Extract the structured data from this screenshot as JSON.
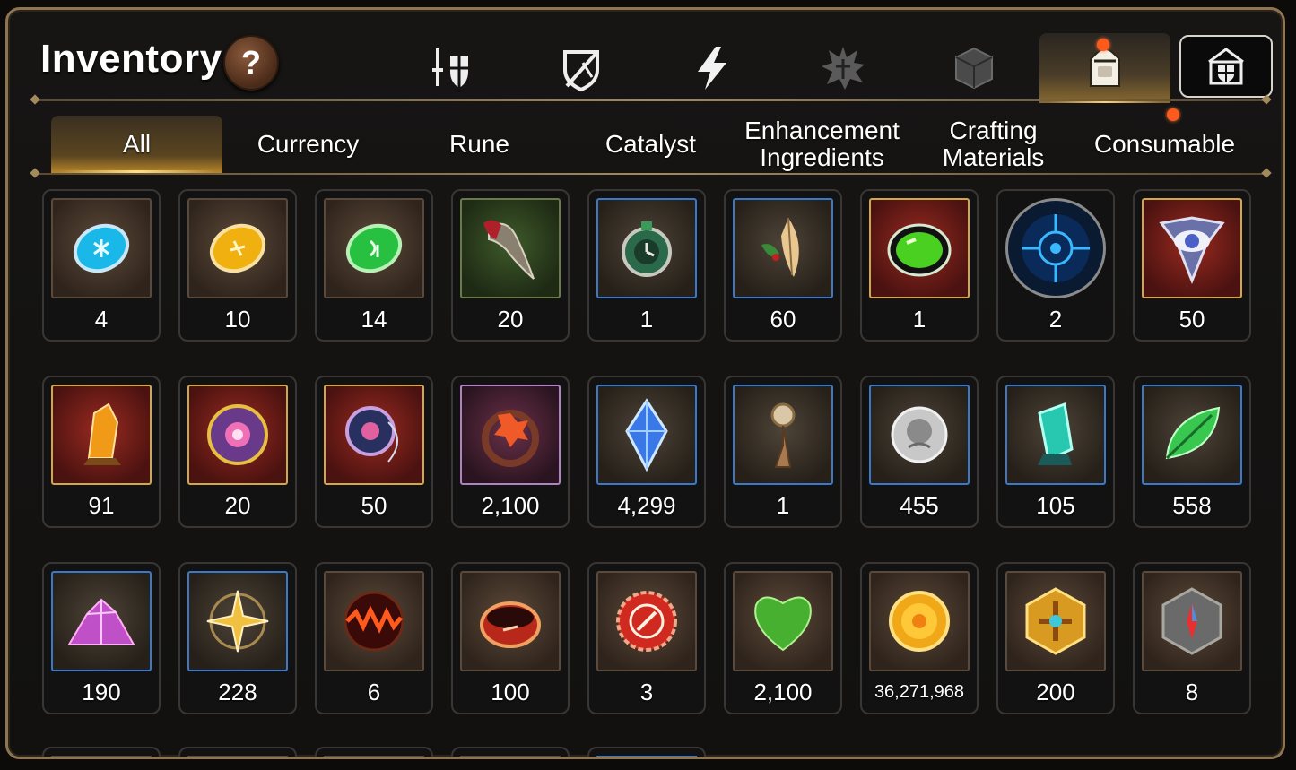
{
  "window": {
    "title": "Inventory",
    "help_label": "?"
  },
  "category_tabs": [
    {
      "icon": "knight-shield-icon",
      "active": false
    },
    {
      "icon": "broken-shield-icon",
      "active": false
    },
    {
      "icon": "lightning-icon",
      "active": false
    },
    {
      "icon": "rune-burst-icon",
      "active": false
    },
    {
      "icon": "cube-icon",
      "active": false
    },
    {
      "icon": "backpack-icon",
      "active": true,
      "notification": true
    }
  ],
  "guild_button": {
    "icon": "guild-castle-icon"
  },
  "subtabs": [
    {
      "label": "All",
      "active": true
    },
    {
      "label": "Currency",
      "active": false
    },
    {
      "label": "Rune",
      "active": false
    },
    {
      "label": "Catalyst",
      "active": false
    },
    {
      "label": "Enhancement\nIngredients",
      "active": false
    },
    {
      "label": "Crafting\nMaterials",
      "active": false
    },
    {
      "label": "Consumable",
      "active": false,
      "notification": true
    }
  ],
  "items": [
    {
      "icon": "blue-gem-icon",
      "count": "4",
      "rarity": "common"
    },
    {
      "icon": "yellow-gem-icon",
      "count": "10",
      "rarity": "common"
    },
    {
      "icon": "green-gem-icon",
      "count": "14",
      "rarity": "common"
    },
    {
      "icon": "claw-icon",
      "count": "20",
      "rarity": "uncommon"
    },
    {
      "icon": "pocket-watch-icon",
      "count": "1",
      "rarity": "rare"
    },
    {
      "icon": "feather-charm-icon",
      "count": "60",
      "rarity": "rare"
    },
    {
      "icon": "green-orb-icon",
      "count": "1",
      "rarity": "legend"
    },
    {
      "icon": "blue-rune-circle-icon",
      "count": "2",
      "rarity": "circle"
    },
    {
      "icon": "eye-emblem-icon",
      "count": "50",
      "rarity": "legend"
    },
    {
      "icon": "amber-crystal-icon",
      "count": "91",
      "rarity": "legend"
    },
    {
      "icon": "violet-disc-icon",
      "count": "20",
      "rarity": "legend"
    },
    {
      "icon": "amulet-icon",
      "count": "50",
      "rarity": "legend"
    },
    {
      "icon": "flower-ring-icon",
      "count": "2,100",
      "rarity": "epic"
    },
    {
      "icon": "blue-crystal-icon",
      "count": "4,299",
      "rarity": "rare"
    },
    {
      "icon": "pendulum-icon",
      "count": "1",
      "rarity": "rare"
    },
    {
      "icon": "silver-coin-icon",
      "count": "455",
      "rarity": "rare"
    },
    {
      "icon": "teal-crystal-icon",
      "count": "105",
      "rarity": "rare"
    },
    {
      "icon": "green-leaf-icon",
      "count": "558",
      "rarity": "rare"
    },
    {
      "icon": "pink-ore-icon",
      "count": "190",
      "rarity": "rare"
    },
    {
      "icon": "star-compass-icon",
      "count": "228",
      "rarity": "rare"
    },
    {
      "icon": "lava-orb-icon",
      "count": "6",
      "rarity": "common"
    },
    {
      "icon": "red-ring-icon",
      "count": "100",
      "rarity": "common"
    },
    {
      "icon": "red-badge-icon",
      "count": "3",
      "rarity": "common"
    },
    {
      "icon": "green-heart-icon",
      "count": "2,100",
      "rarity": "common"
    },
    {
      "icon": "gold-coin-icon",
      "count": "36,271,968",
      "rarity": "common"
    },
    {
      "icon": "gold-hexagon-icon",
      "count": "200",
      "rarity": "common"
    },
    {
      "icon": "stone-compass-icon",
      "count": "8",
      "rarity": "common"
    }
  ],
  "colors": {
    "frame": "#8c7550",
    "accent_gold": "#b8862c",
    "notification": "#ff5a1e",
    "rare_border": "#3a78c8",
    "legend_border": "#d0a84a",
    "epic_border": "#b082c0"
  }
}
